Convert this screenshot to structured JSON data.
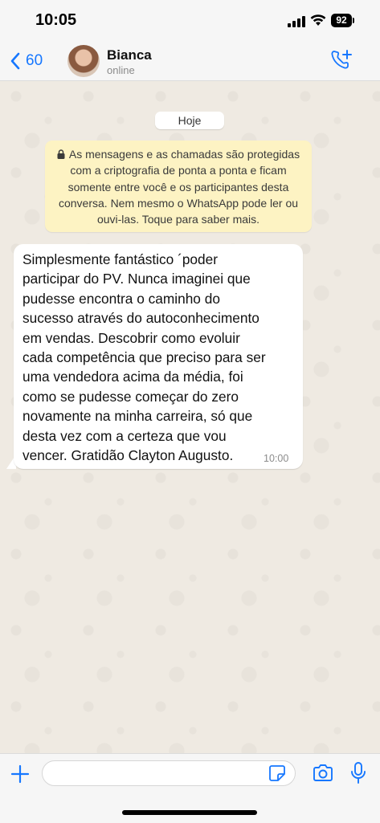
{
  "status_bar": {
    "time": "10:05",
    "battery": "92"
  },
  "header": {
    "back_count": "60",
    "contact_name": "Bianca",
    "contact_status": "online"
  },
  "chat": {
    "date_chip": "Hoje",
    "encryption_notice": "As mensagens e as chamadas são protegidas com a criptografia de ponta a ponta e ficam somente entre você e os participantes desta conversa. Nem mesmo o WhatsApp pode ler ou ouvi-las. Toque para saber mais.",
    "messages": [
      {
        "text": "Simplesmente fantástico ´poder\nparticipar do PV. Nunca imaginei que\npudesse encontra o caminho do\nsucesso através do autoconhecimento\nem vendas. Descobrir como evoluir\ncada competência que preciso para ser\numa vendedora acima da média, foi\ncomo se pudesse começar do zero\nnovamente na minha carreira, só que\ndesta vez com a certeza que vou\nvencer. Gratidão Clayton Augusto.",
        "time": "10:00"
      }
    ]
  },
  "input_bar": {
    "placeholder": ""
  },
  "colors": {
    "accent": "#1677ff",
    "notice_bg": "#fdf3c3",
    "wallpaper": "#efeae2"
  }
}
